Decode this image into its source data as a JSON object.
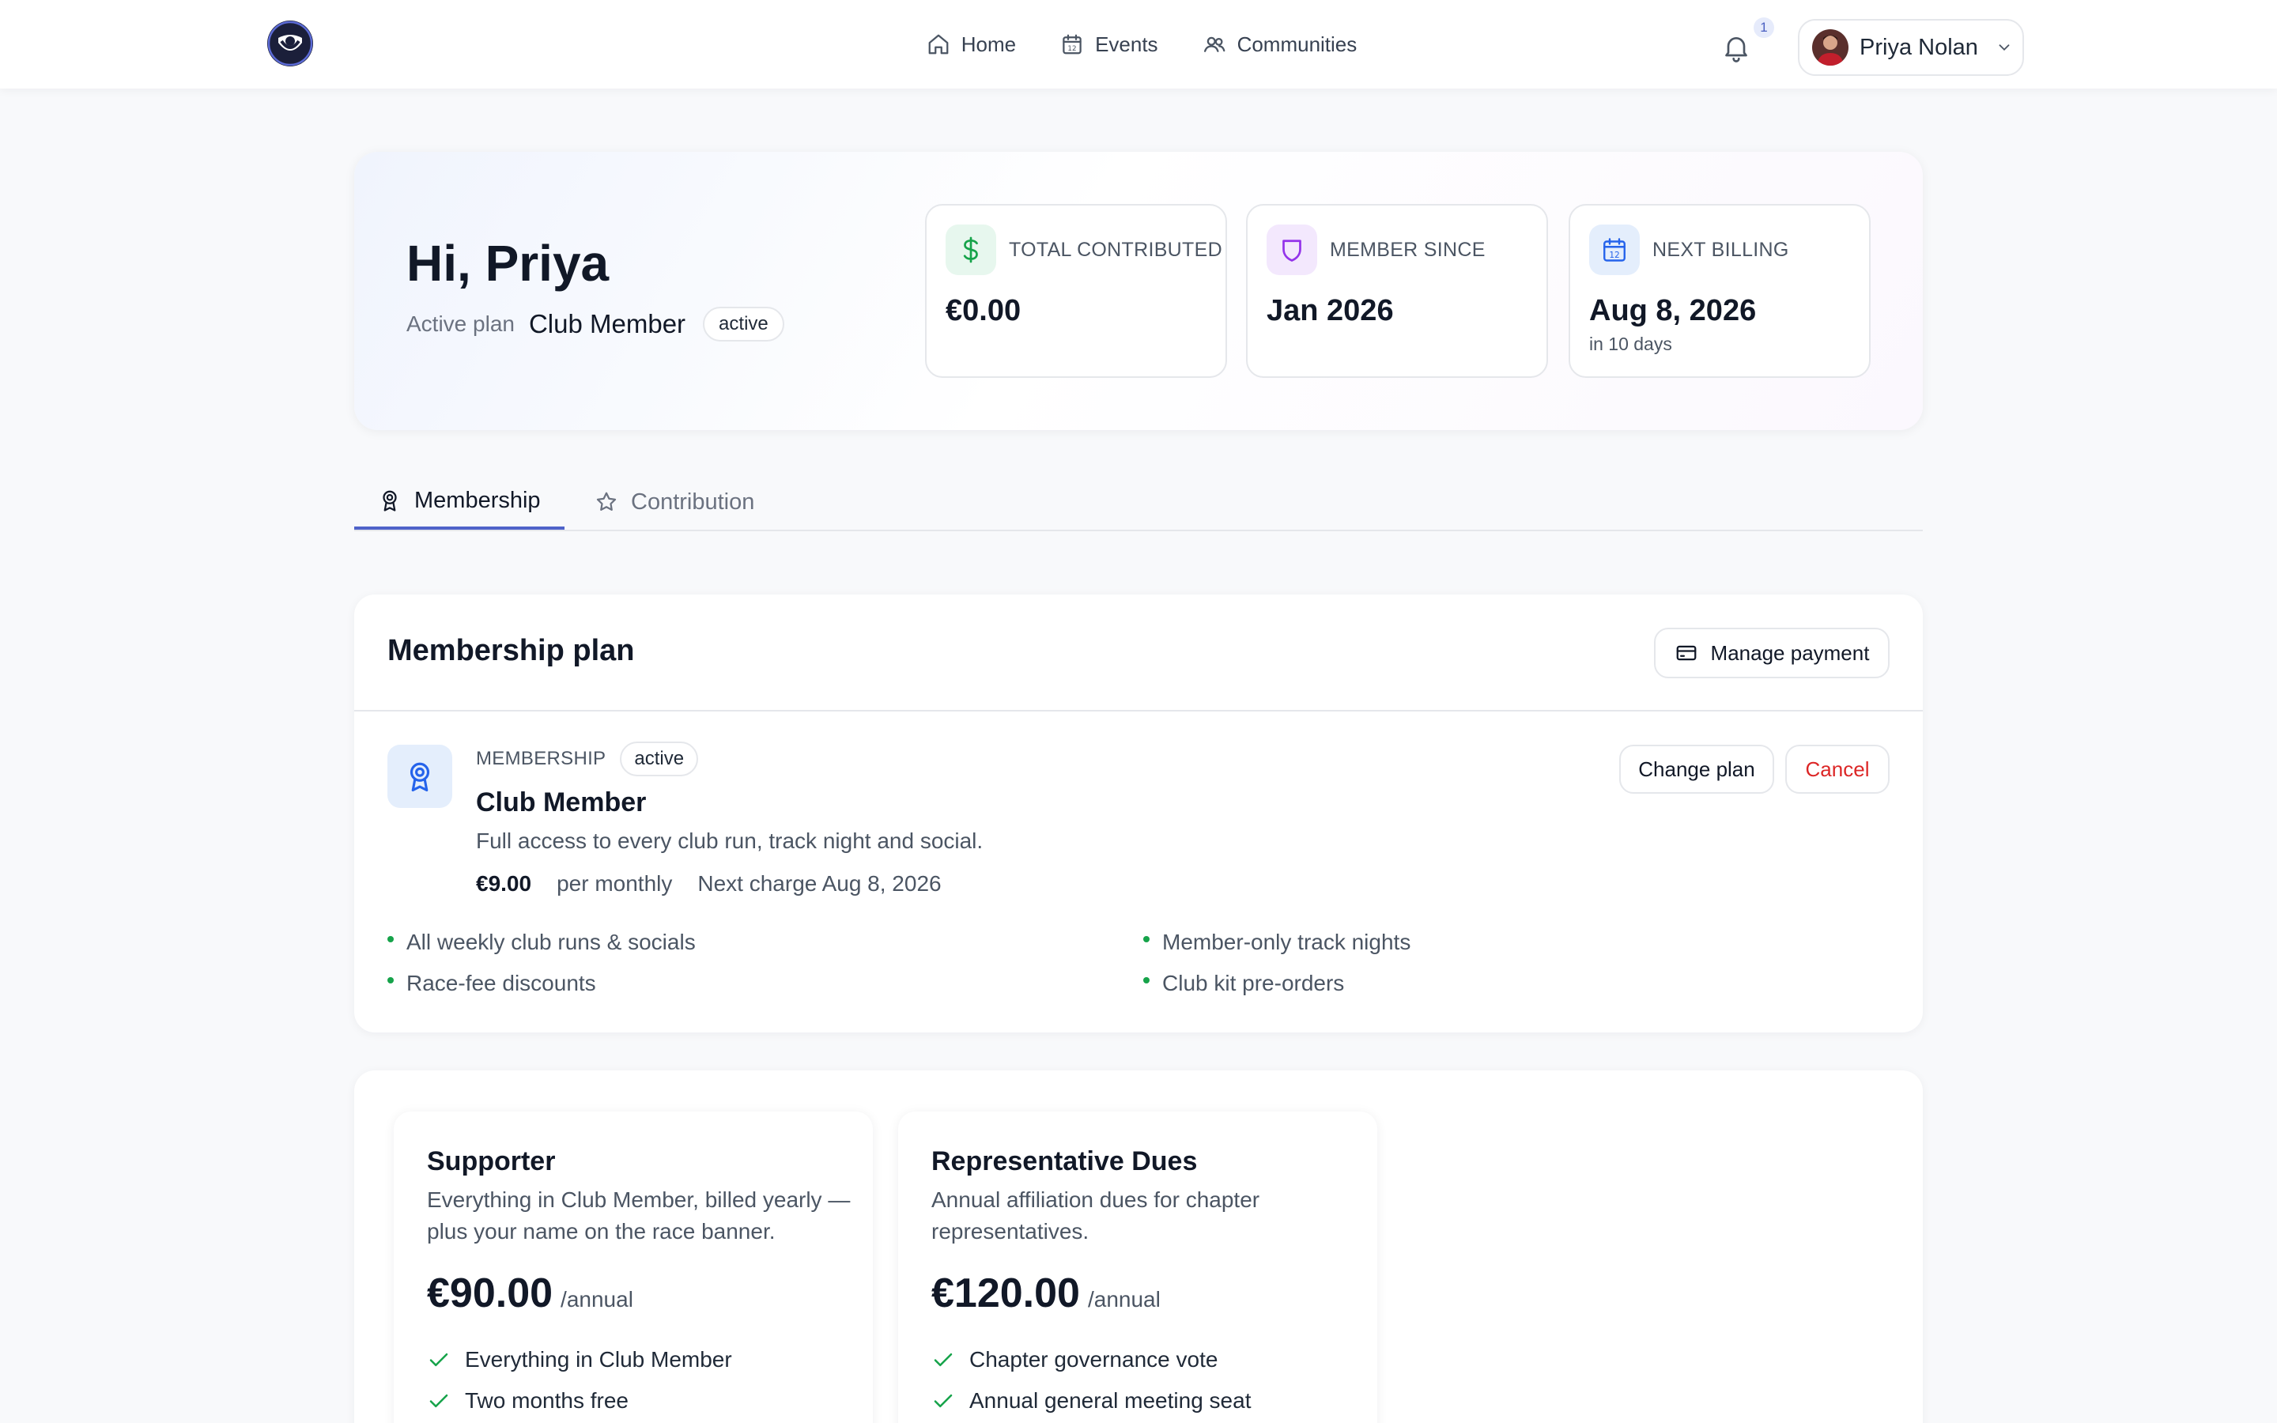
{
  "nav": {
    "links": [
      {
        "label": "Home",
        "icon": "home-icon"
      },
      {
        "label": "Events",
        "icon": "calendar-icon"
      },
      {
        "label": "Communities",
        "icon": "users-icon"
      }
    ],
    "notification_count": "1",
    "user_name": "Priya Nolan"
  },
  "hero": {
    "greeting": "Hi, Priya",
    "active_plan_label": "Active plan",
    "active_plan_name": "Club Member",
    "status": "active",
    "stats": [
      {
        "label": "TOTAL CONTRIBUTED",
        "value": "€0.00",
        "sub": "",
        "icon": "dollar-icon",
        "color": "#16a34a",
        "bg": "#e7f7ee"
      },
      {
        "label": "MEMBER SINCE",
        "value": "Jan 2026",
        "sub": "",
        "icon": "shield-icon",
        "color": "#9333ea",
        "bg": "#f3e8fd"
      },
      {
        "label": "NEXT BILLING",
        "value": "Aug 8, 2026",
        "sub": "in 10 days",
        "icon": "calendar-icon",
        "color": "#2563eb",
        "bg": "#e4eefc"
      }
    ]
  },
  "tabs": [
    {
      "label": "Membership",
      "active": true,
      "icon": "award-icon"
    },
    {
      "label": "Contribution",
      "active": false,
      "icon": "star-icon"
    }
  ],
  "membership": {
    "title": "Membership plan",
    "manage_payment": "Manage payment",
    "kicker": "MEMBERSHIP",
    "status": "active",
    "plan_name": "Club Member",
    "description": "Full access to every club run, track night and social.",
    "price": "€9.00",
    "period": "per monthly",
    "next_charge": "Next charge Aug 8, 2026",
    "change_plan": "Change plan",
    "cancel": "Cancel",
    "features": [
      "All weekly club runs & socials",
      "Member-only track nights",
      "Race-fee discounts",
      "Club kit pre-orders"
    ]
  },
  "alternatives": [
    {
      "name": "Supporter",
      "description": "Everything in Club Member, billed yearly — plus your name on the race banner.",
      "price": "€90.00",
      "per": "/annual",
      "features": [
        "Everything in Club Member",
        "Two months free"
      ]
    },
    {
      "name": "Representative Dues",
      "description": "Annual affiliation dues for chapter representatives.",
      "price": "€120.00",
      "per": "/annual",
      "features": [
        "Chapter governance vote",
        "Annual general meeting seat"
      ]
    }
  ],
  "colors": {
    "accent": "#4f63c9",
    "cancel": "#dc2626",
    "check": "#16a34a"
  }
}
